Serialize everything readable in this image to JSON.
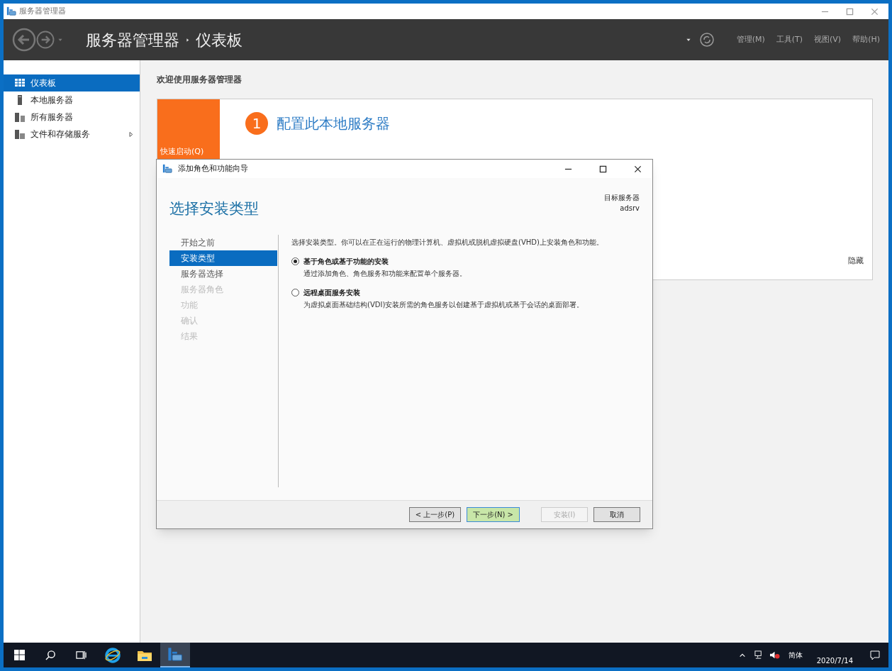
{
  "window": {
    "title": "服务器管理器"
  },
  "header": {
    "breadcrumb": [
      "服务器管理器",
      "仪表板"
    ],
    "menus": [
      "管理(M)",
      "工具(T)",
      "视图(V)",
      "帮助(H)"
    ]
  },
  "sidebar": {
    "items": [
      {
        "label": "仪表板",
        "selected": true,
        "expandable": false
      },
      {
        "label": "本地服务器",
        "selected": false,
        "expandable": false
      },
      {
        "label": "所有服务器",
        "selected": false,
        "expandable": false
      },
      {
        "label": "文件和存储服务",
        "selected": false,
        "expandable": true
      }
    ]
  },
  "dashboard": {
    "welcome": "欢迎使用服务器管理器",
    "quick_start": "快速启动(Q)",
    "step_number": "1",
    "step_title": "配置此本地服务器",
    "hide": "隐藏"
  },
  "dialog": {
    "title": "添加角色和功能向导",
    "heading": "选择安装类型",
    "target_label": "目标服务器",
    "target_server": "adsrv",
    "nav": [
      {
        "label": "开始之前",
        "selected": false,
        "disabled": false
      },
      {
        "label": "安装类型",
        "selected": true,
        "disabled": false
      },
      {
        "label": "服务器选择",
        "selected": false,
        "disabled": false
      },
      {
        "label": "服务器角色",
        "selected": false,
        "disabled": true
      },
      {
        "label": "功能",
        "selected": false,
        "disabled": true
      },
      {
        "label": "确认",
        "selected": false,
        "disabled": true
      },
      {
        "label": "结果",
        "selected": false,
        "disabled": true
      }
    ],
    "intro": "选择安装类型。你可以在正在运行的物理计算机、虚拟机或脱机虚拟硬盘(VHD)上安装角色和功能。",
    "options": [
      {
        "label": "基于角色或基于功能的安装",
        "description": "通过添加角色、角色服务和功能来配置单个服务器。",
        "selected": true
      },
      {
        "label": "远程桌面服务安装",
        "description": "为虚拟桌面基础结构(VDI)安装所需的角色服务以创建基于虚拟机或基于会话的桌面部署。",
        "selected": false
      }
    ],
    "buttons": [
      {
        "label": "< 上一步(P)",
        "disabled": false,
        "focused": false
      },
      {
        "label": "下一步(N) >",
        "disabled": false,
        "focused": true
      },
      {
        "label": "安装(I)",
        "disabled": true,
        "focused": false
      },
      {
        "label": "取消",
        "disabled": false,
        "focused": false
      }
    ]
  },
  "taskbar": {
    "language": "简体",
    "date": "2020/7/14"
  }
}
